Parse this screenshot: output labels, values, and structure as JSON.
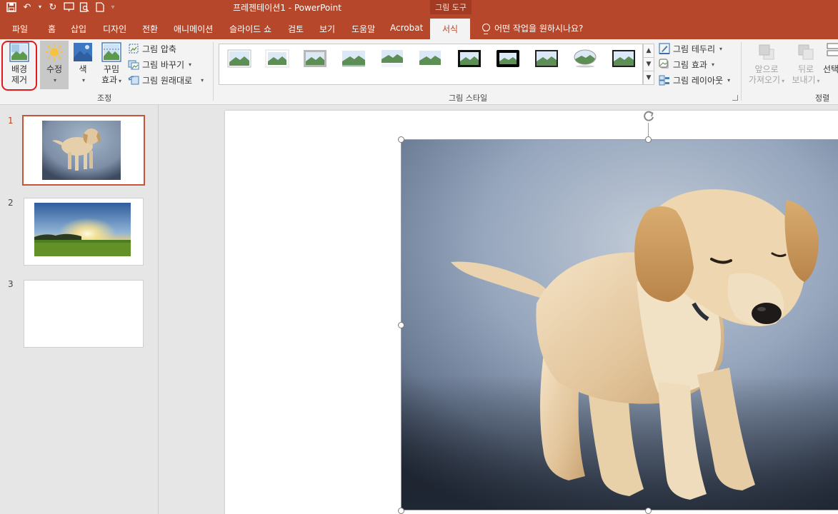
{
  "titlebar": {
    "title": "프레젠테이션1  -  PowerPoint",
    "context_group": "그림 도구"
  },
  "tabs": [
    {
      "label": "파일"
    },
    {
      "label": "홈"
    },
    {
      "label": "삽입"
    },
    {
      "label": "디자인"
    },
    {
      "label": "전환"
    },
    {
      "label": "애니메이션"
    },
    {
      "label": "슬라이드 쇼"
    },
    {
      "label": "검토"
    },
    {
      "label": "보기"
    },
    {
      "label": "도움말"
    },
    {
      "label": "Acrobat"
    },
    {
      "label": "서식",
      "active": true
    }
  ],
  "tell_me": "어떤 작업을 원하시나요?",
  "ribbon": {
    "adjust": {
      "remove_bg": {
        "line1": "배경",
        "line2": "제거"
      },
      "corrections": "수정",
      "color": "색",
      "artistic": {
        "line1": "꾸밈",
        "line2": "효과"
      },
      "compress": "그림 압축",
      "change": "그림 바꾸기",
      "reset": "그림 원래대로",
      "group_label": "조정"
    },
    "styles": {
      "group_label": "그림 스타일",
      "border": "그림 테두리",
      "effects": "그림 효과",
      "layout": "그림 레이아웃"
    },
    "arrange": {
      "bring_forward": {
        "line1": "앞으로",
        "line2": "가져오기"
      },
      "send_backward": {
        "line1": "뒤로",
        "line2": "보내기"
      },
      "selection": "선택",
      "group_label": "정렬"
    }
  },
  "slides": [
    {
      "number": "1",
      "active": true
    },
    {
      "number": "2"
    },
    {
      "number": "3"
    }
  ],
  "colors": {
    "accent": "#b7472a",
    "highlight": "#e01b1b"
  }
}
